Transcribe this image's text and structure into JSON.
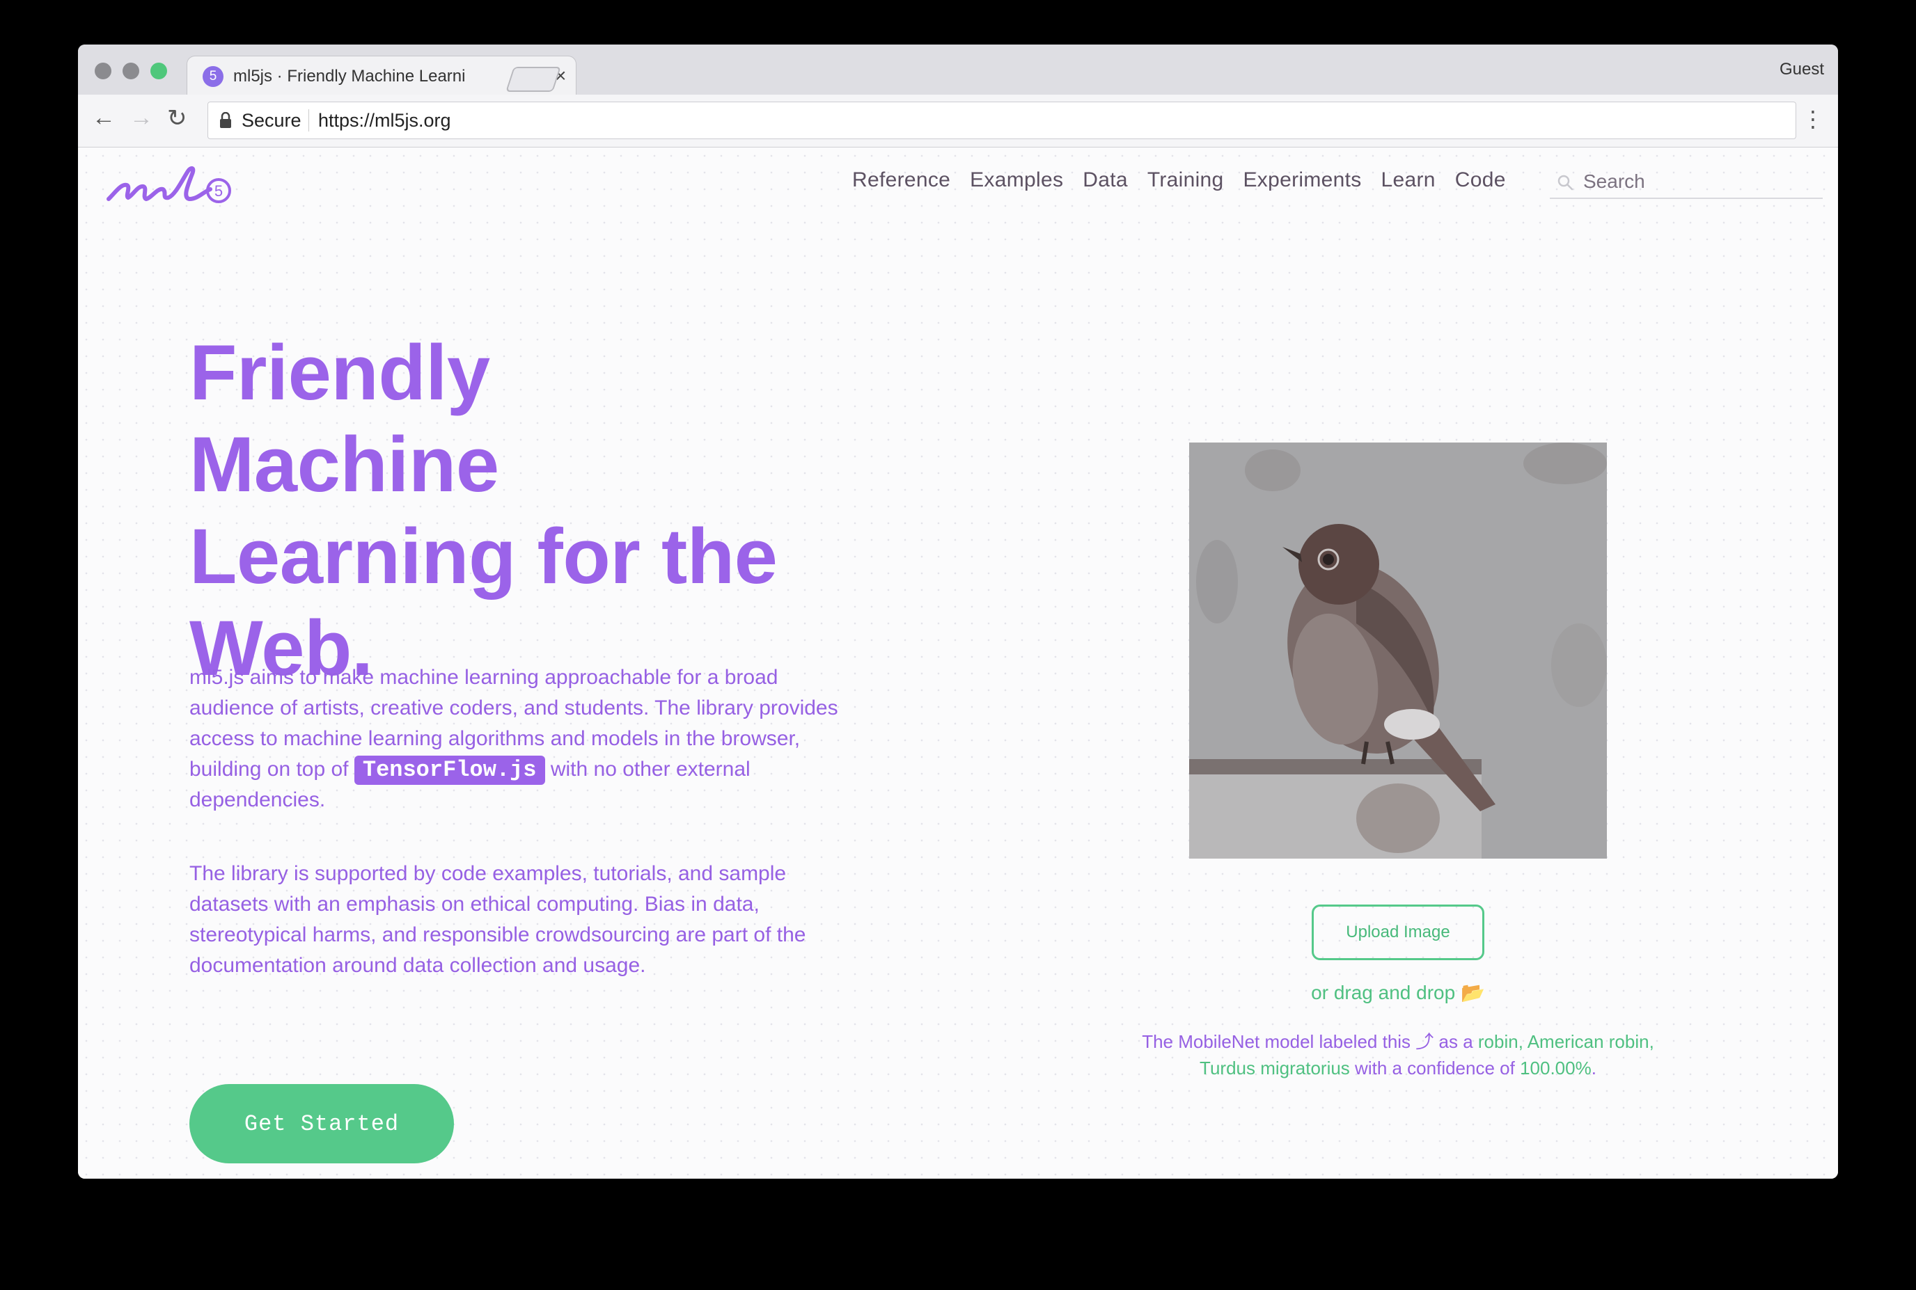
{
  "browser": {
    "tab_title": "ml5js · Friendly Machine Learni",
    "tab_favicon": "5",
    "tab_close": "×",
    "profile": "Guest",
    "secure_label": "Secure",
    "url": "https://ml5js.org",
    "icons": {
      "back": "arrow-left-icon",
      "forward": "arrow-right-icon",
      "reload": "reload-icon",
      "menu": "more-vertical-icon",
      "lock": "lock-icon"
    }
  },
  "site": {
    "logo_badge": "5",
    "nav": [
      "Reference",
      "Examples",
      "Data",
      "Training",
      "Experiments",
      "Learn",
      "Code"
    ],
    "search_placeholder": "Search"
  },
  "hero": {
    "title": "Friendly Machine Learning for the Web.",
    "para1_before": "ml5.js aims to make machine learning approachable for a broad audience of artists, creative coders, and students. The library provides access to machine learning algorithms and models in the browser, building on top of ",
    "para1_badge": "TensorFlow.js",
    "para1_after": " with no other external dependencies.",
    "para2": "The library is supported by code examples, tutorials, and sample datasets with an emphasis on ethical computing. Bias in data, stereotypical harms, and responsible crowdsourcing are part of the documentation around data collection and usage.",
    "cta": "Get Started"
  },
  "demo": {
    "upload_label": "Upload Image",
    "drag_drop": "or drag and drop 📂",
    "result_prefix": "The MobileNet model labeled this ⤴ as a ",
    "result_label": "robin, American robin, Turdus migratorius",
    "result_mid": " with a confidence of ",
    "result_confidence": "100.00%",
    "result_end": "."
  },
  "colors": {
    "accent_purple": "#9b63e9",
    "accent_green": "#55c98a",
    "nav_text": "#5c5162"
  }
}
